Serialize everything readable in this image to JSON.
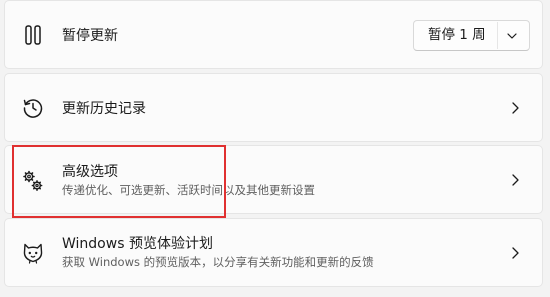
{
  "pause_updates": {
    "title": "暂停更新",
    "icon": "pause-icon",
    "dropdown": {
      "selected": "暂停 1 周",
      "icon": "chevron-down-icon"
    }
  },
  "update_history": {
    "title": "更新历史记录",
    "icon": "history-icon",
    "chevron": "chevron-right-icon"
  },
  "advanced_options": {
    "title": "高级选项",
    "subtitle": "传递优化、可选更新、活跃时间以及其他更新设置",
    "icon": "gears-icon",
    "chevron": "chevron-right-icon"
  },
  "insider_program": {
    "title": "Windows 预览体验计划",
    "subtitle": "获取 Windows 的预览版本，以分享有关新功能和更新的反馈",
    "icon": "insider-cat-icon",
    "chevron": "chevron-right-icon"
  },
  "colors": {
    "background": "#f3f3f3",
    "card": "#fbfbfb",
    "highlight_border": "#e03030",
    "secondary_text": "#5f5f5f"
  }
}
